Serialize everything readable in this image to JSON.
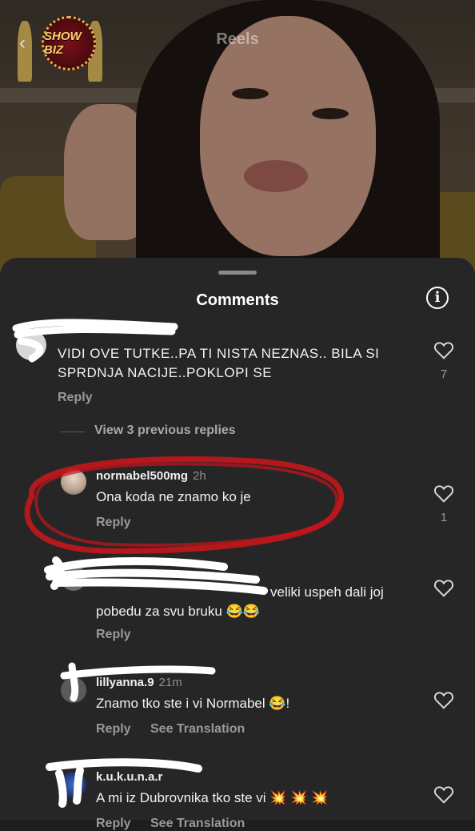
{
  "header": {
    "title": "Reels",
    "logo_text": "SHOW BIZ"
  },
  "sheet": {
    "title": "Comments",
    "info_icon": "info-icon"
  },
  "comments": [
    {
      "username": "",
      "time": "",
      "text": "VIDI OVE TUTKE..PA TI NISTA NEZNAS.. BILA SI SPRDNJA NACIJE..POKLOPI SE",
      "reply": "Reply",
      "likes": "7"
    },
    {
      "view_previous": "View 3 previous replies"
    },
    {
      "username": "normabel500mg",
      "time": "2h",
      "text": "Ona koda ne znamo ko je",
      "reply": "Reply",
      "likes": "1"
    },
    {
      "username": "",
      "time": "",
      "text_mention": "",
      "text": "veliki uspeh dali joj pobedu za svu bruku 😂😂",
      "reply": "Reply",
      "likes": ""
    },
    {
      "username": "lillyanna.9",
      "time": "21m",
      "text": "Znamo tko ste i vi Normabel 😂!",
      "reply": "Reply",
      "see_translation": "See Translation",
      "likes": ""
    },
    {
      "username": "k.u.k.u.n.a.r",
      "time": "",
      "text": "A mi iz Dubrovnika tko ste vi 💥 💥 💥",
      "reply": "Reply",
      "see_translation": "See Translation",
      "likes": ""
    }
  ],
  "colors": {
    "sheet_bg": "#262626",
    "annotation_red": "#c4161c",
    "mention": "#8fa6ff"
  }
}
